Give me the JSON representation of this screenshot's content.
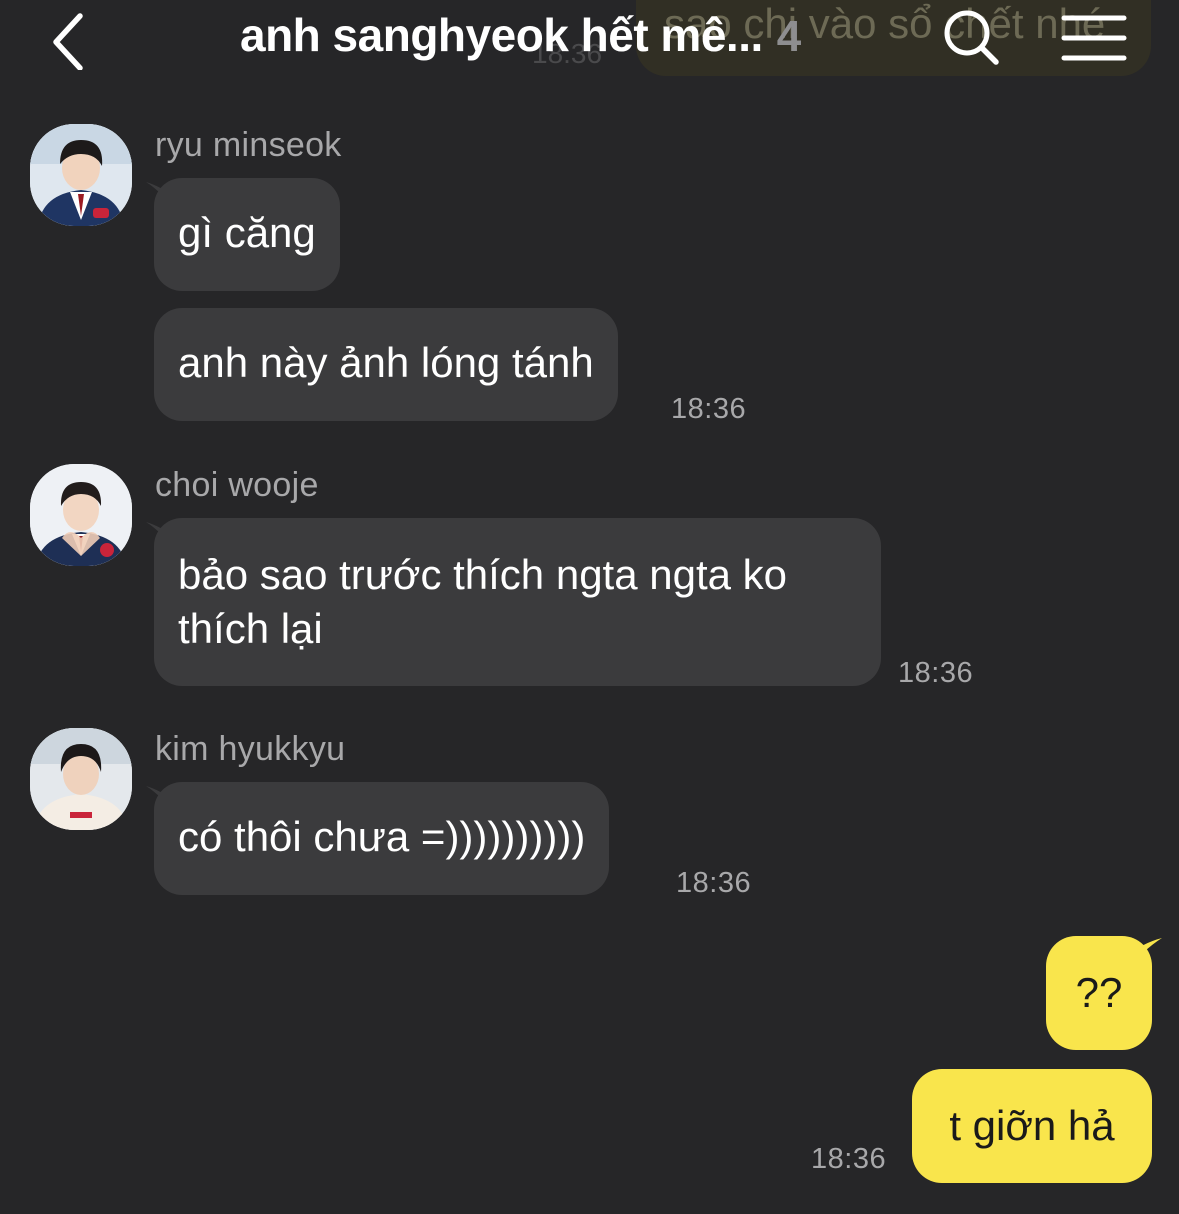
{
  "header": {
    "title": "anh sanghyeok hết mê...",
    "member_count": "4",
    "ghost_message": "sao chi vào sổ chết nhé",
    "ghost_time": "18:36"
  },
  "colors": {
    "background": "#262628",
    "incoming_bubble": "#3b3b3d",
    "outgoing_bubble": "#f9e54c",
    "secondary_text": "#a8a8aa"
  },
  "icons": {
    "back": "chevron-left-icon",
    "search": "search-icon",
    "menu": "hamburger-menu-icon"
  },
  "messages": [
    {
      "sender": "ryu minseok",
      "bubbles": [
        "gì căng",
        "anh này ảnh lóng tánh"
      ],
      "time": "18:36"
    },
    {
      "sender": "choi wooje",
      "bubbles": [
        "bảo sao trước thích ngta ngta ko thích lại"
      ],
      "time": "18:36"
    },
    {
      "sender": "kim hyukkyu",
      "bubbles": [
        "có thôi chưa =))))))))))"
      ],
      "time": "18:36"
    }
  ],
  "my_messages": {
    "bubbles": [
      "??",
      "t giỡn hả"
    ],
    "time": "18:36"
  }
}
